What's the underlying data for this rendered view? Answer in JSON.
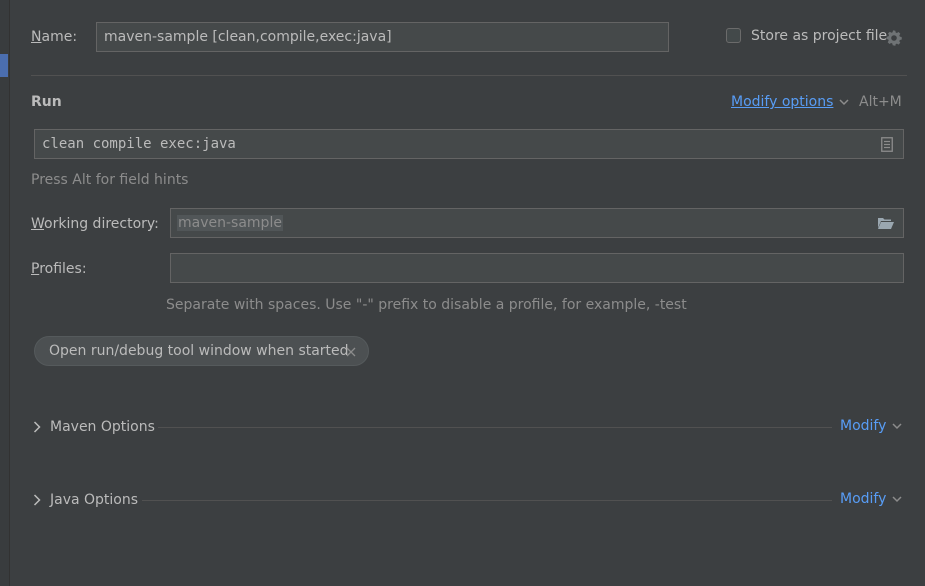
{
  "name_row": {
    "label_mnemonic": "N",
    "label_rest": "ame:",
    "value": "maven-sample [clean,compile,exec:java]",
    "store_label": "Store as project file",
    "store_checked": false
  },
  "run_section": {
    "title": "Run",
    "modify_options": "Modify options",
    "modify_shortcut": "Alt+M",
    "command": "clean compile exec:java",
    "hint": "Press Alt for field hints"
  },
  "working_dir": {
    "label_mnemonic": "W",
    "label_rest": "orking directory:",
    "value": "maven-sample"
  },
  "profiles": {
    "label_mnemonic": "P",
    "label_rest": "rofiles:",
    "value": "",
    "hint": "Separate with spaces. Use \"-\" prefix to disable a profile, for example, -test"
  },
  "chip": {
    "label": "Open run/debug tool window when started"
  },
  "maven_options": {
    "label": "Maven Options",
    "modify": "Modify"
  },
  "java_options": {
    "label": "Java Options",
    "modify": "Modify"
  },
  "colors": {
    "background": "#3c3f41",
    "link": "#589df6",
    "field_bg": "#45494a",
    "accent_strip": "#4b6eaf"
  }
}
